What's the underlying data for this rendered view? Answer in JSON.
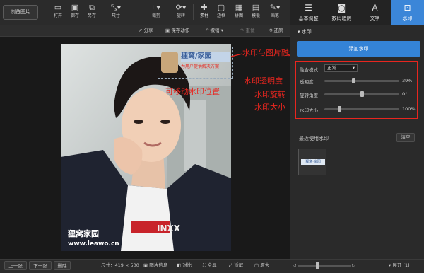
{
  "toolbar": {
    "browse_label": "浏览图片",
    "buttons": [
      {
        "label": "打开",
        "icon": "folder-icon"
      },
      {
        "label": "保存",
        "icon": "save-icon"
      },
      {
        "label": "另存",
        "icon": "save-as-icon"
      },
      {
        "label": "尺寸",
        "icon": "resize-icon"
      },
      {
        "label": "裁剪",
        "icon": "crop-icon"
      },
      {
        "label": "旋转",
        "icon": "rotate-icon"
      },
      {
        "label": "素材",
        "icon": "material-icon"
      },
      {
        "label": "边框",
        "icon": "border-icon"
      },
      {
        "label": "拼图",
        "icon": "collage-icon"
      },
      {
        "label": "模板",
        "icon": "template-icon"
      },
      {
        "label": "画笔",
        "icon": "brush-icon"
      }
    ]
  },
  "right_tabs": [
    {
      "label": "基本调整",
      "icon": "sliders-icon"
    },
    {
      "label": "数码暗房",
      "icon": "camera-icon"
    },
    {
      "label": "文字",
      "icon": "text-icon"
    },
    {
      "label": "水印",
      "icon": "watermark-icon"
    }
  ],
  "subbar": {
    "share": "分享",
    "save_action": "保存动作",
    "undo": "撤销",
    "redo": "重做",
    "restore": "还原"
  },
  "watermark": {
    "logo_title": "狸窝/家园",
    "logo_sub": "为用户提供解决方案",
    "bottom_text1": "狸窝家园",
    "bottom_text2": "www.leawo.cn"
  },
  "shirt_text": "INXX",
  "annotations": {
    "blend": "水印与图片融合模式",
    "movable": "可移动水印位置",
    "opacity": "水印透明度",
    "rotate": "水印旋转",
    "size": "水印大小"
  },
  "panel": {
    "section_title": "水印",
    "add_button": "添加水印",
    "blend_label": "融合模式",
    "blend_value": "正常",
    "opacity_label": "透明度",
    "opacity_value": "39%",
    "opacity_level": 0.39,
    "angle_label": "旋转角度",
    "angle_value": "0°",
    "angle_level": 0.5,
    "size_label": "水印大小",
    "size_value": "100%",
    "size_level": 0.2,
    "recent_title": "最近使用水印",
    "clear_button": "清空",
    "thumb_text": "狸窝·家园"
  },
  "bottombar": {
    "prev": "上一张",
    "next": "下一张",
    "delete": "删除",
    "size": "尺寸：419 × 500",
    "info": "图片信息",
    "compare": "对比",
    "fullscreen": "全屏",
    "fit": "适屏",
    "original": "原大",
    "expand": "展开 (1)"
  }
}
